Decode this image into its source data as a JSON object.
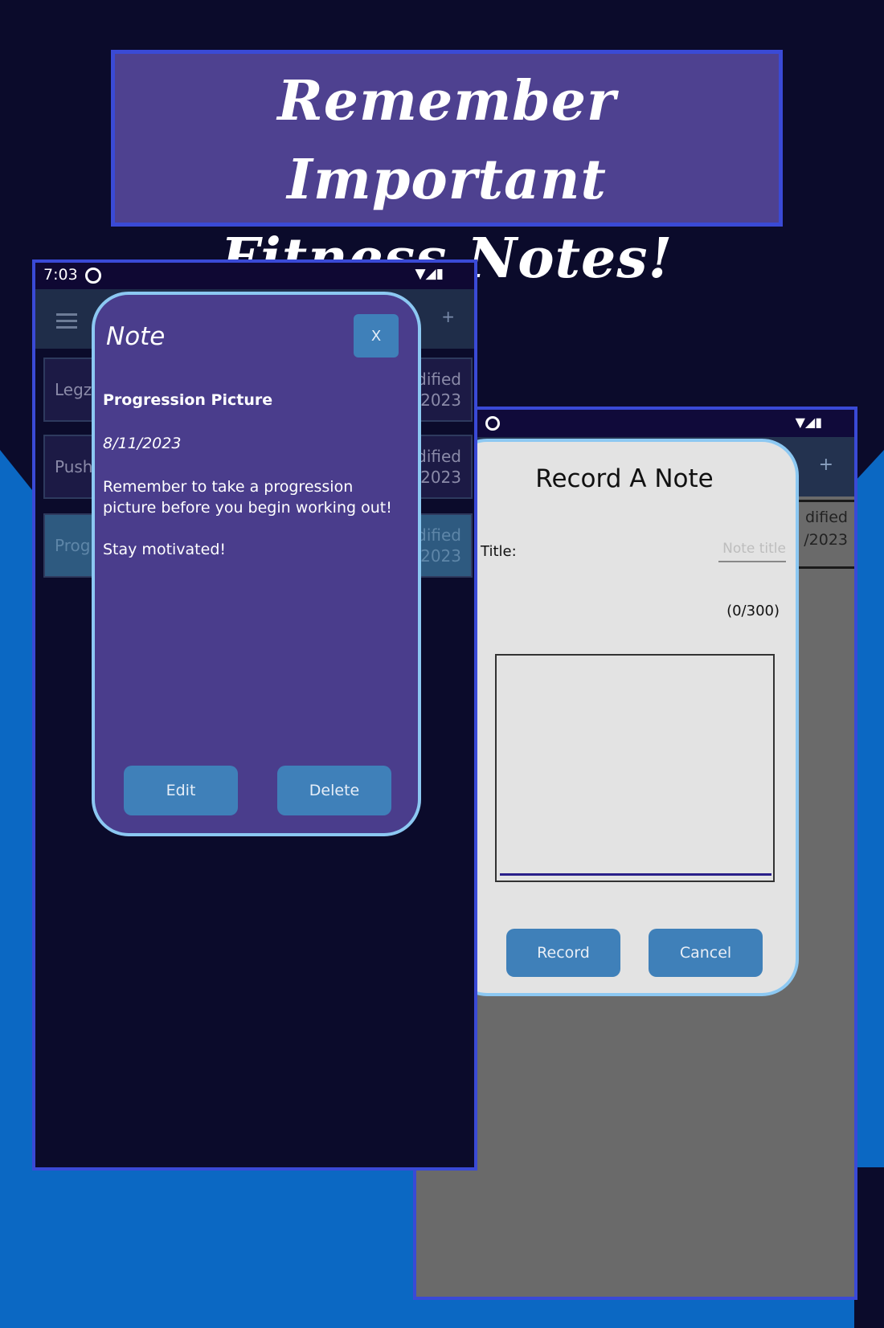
{
  "headline": {
    "line1": "Remember Important",
    "line2": "Fitness Notes!"
  },
  "colors": {
    "background_dark": "#0b0b2b",
    "background_blue": "#0b68c3",
    "frame_border": "#3a4ad6",
    "banner_fill": "#4e4190",
    "modal_border": "#8cc8f2",
    "button_blue": "#3f80b9",
    "note_modal_fill": "#4a3d8c"
  },
  "phone_left": {
    "status_bar": {
      "time": "7:03",
      "icons": "gear-icon, wifi-icon, signal-icon, battery-icon"
    },
    "app_bar": {
      "plus": "+"
    },
    "notes_list": [
      {
        "name": "Legz",
        "modified_line1": "dified",
        "modified_line2": "/2023"
      },
      {
        "name": "Push",
        "modified_line1": "dified",
        "modified_line2": "/2023"
      },
      {
        "name": "Progr",
        "modified_line1": "dified",
        "modified_line2": "/2023"
      }
    ],
    "note_modal": {
      "title": "Note",
      "close_label": "X",
      "note_title": "Progression Picture",
      "date": "8/11/2023",
      "body_paragraph1": "Remember to take a progression picture before you begin working out!",
      "body_paragraph2": "Stay motivated!",
      "edit_label": "Edit",
      "delete_label": "Delete"
    }
  },
  "phone_right": {
    "app_bar": {
      "plus": "+"
    },
    "partial_card": {
      "modified_line1": "dified",
      "modified_line2": "/2023"
    },
    "record_modal": {
      "title": "Record A Note",
      "title_label": "Title:",
      "title_placeholder": "Note title",
      "char_count": "(0/300)",
      "record_label": "Record",
      "cancel_label": "Cancel"
    }
  }
}
